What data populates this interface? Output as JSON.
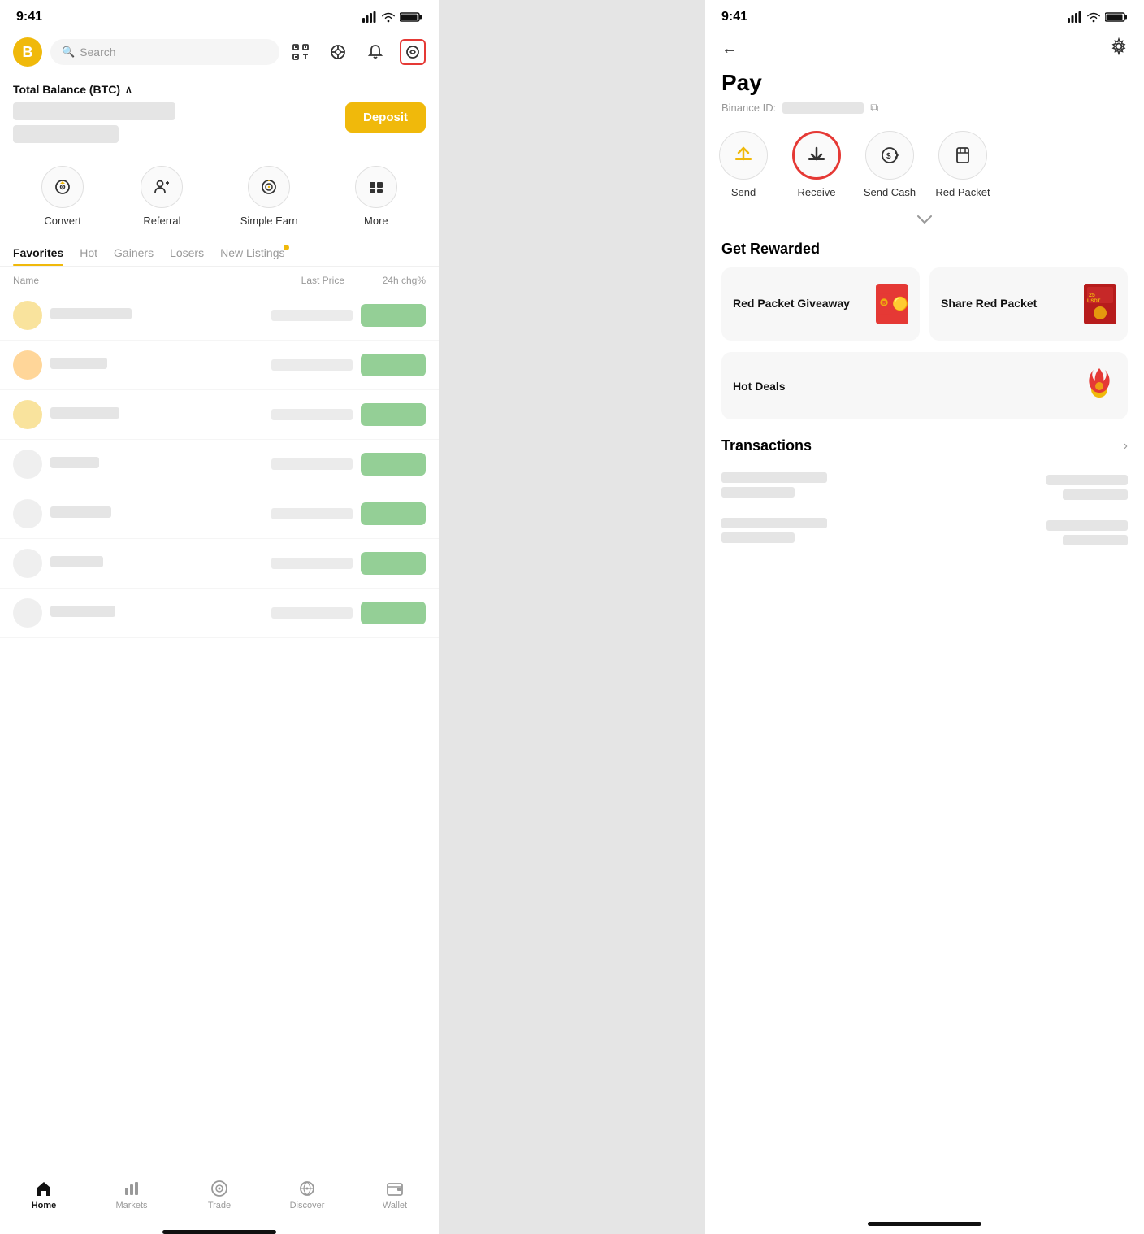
{
  "left": {
    "status": {
      "time": "9:41",
      "signal": "▌▌▌▌",
      "wifi": "WiFi",
      "battery": "🔋"
    },
    "search": {
      "placeholder": "Search"
    },
    "topbar_icons": [
      "⊞",
      "🎧",
      "🔔"
    ],
    "pay_icon_label": "pay-icon",
    "balance": {
      "label": "Total Balance (BTC)",
      "caret": "∧",
      "deposit_label": "Deposit"
    },
    "quick_actions": [
      {
        "id": "convert",
        "label": "Convert",
        "icon": "↻"
      },
      {
        "id": "referral",
        "label": "Referral",
        "icon": "👤+"
      },
      {
        "id": "simple-earn",
        "label": "Simple Earn",
        "icon": "◎"
      },
      {
        "id": "more",
        "label": "More",
        "icon": "⠿"
      }
    ],
    "market_tabs": [
      {
        "id": "favorites",
        "label": "Favorites",
        "active": true
      },
      {
        "id": "hot",
        "label": "Hot"
      },
      {
        "id": "gainers",
        "label": "Gainers"
      },
      {
        "id": "losers",
        "label": "Losers"
      },
      {
        "id": "new-listings",
        "label": "New Listings",
        "dot": true
      }
    ],
    "market_headers": {
      "name": "Name",
      "price": "Last Price",
      "change": "24h chg%"
    },
    "market_rows_count": 7,
    "bottom_nav": [
      {
        "id": "home",
        "label": "Home",
        "icon": "⌂",
        "active": true
      },
      {
        "id": "markets",
        "label": "Markets",
        "icon": "📊"
      },
      {
        "id": "trade",
        "label": "Trade",
        "icon": "◎"
      },
      {
        "id": "discover",
        "label": "Discover",
        "icon": "⊛"
      },
      {
        "id": "wallet",
        "label": "Wallet",
        "icon": "🗂"
      }
    ]
  },
  "right": {
    "status": {
      "time": "9:41"
    },
    "page_title": "Pay",
    "binance_id_label": "Binance ID:",
    "copy_icon": "⧉",
    "pay_actions": [
      {
        "id": "send",
        "label": "Send",
        "icon": "↑",
        "highlighted": false
      },
      {
        "id": "receive",
        "label": "Receive",
        "icon": "↓",
        "highlighted": true
      },
      {
        "id": "send-cash",
        "label": "Send Cash",
        "icon": "$→",
        "highlighted": false
      },
      {
        "id": "red-packet",
        "label": "Red Packet",
        "icon": "📦",
        "highlighted": false
      }
    ],
    "get_rewarded_title": "Get Rewarded",
    "reward_cards": [
      {
        "id": "red-packet-giveaway",
        "label": "Red Packet Giveaway",
        "emoji": "red-packet"
      },
      {
        "id": "share-red-packet",
        "label": "Share Red Packet",
        "emoji": "share-red-packet"
      }
    ],
    "hot_deals": {
      "label": "Hot Deals",
      "emoji": "🔥"
    },
    "transactions_title": "Transactions",
    "transactions_count": 2,
    "back_label": "←",
    "settings_label": "⚙"
  }
}
